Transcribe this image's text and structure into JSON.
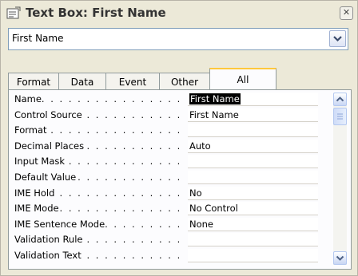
{
  "window": {
    "title": "Text Box: First Name",
    "close_glyph": "✕"
  },
  "object_selector": {
    "value": "First Name"
  },
  "tabs": [
    {
      "label": "Format"
    },
    {
      "label": "Data"
    },
    {
      "label": "Event"
    },
    {
      "label": "Other"
    },
    {
      "label": "All"
    }
  ],
  "active_tab": "All",
  "properties": [
    {
      "label": "Name",
      "value": "First Name"
    },
    {
      "label": "Control Source",
      "value": "First Name"
    },
    {
      "label": "Format",
      "value": ""
    },
    {
      "label": "Decimal Places",
      "value": "Auto"
    },
    {
      "label": "Input Mask",
      "value": ""
    },
    {
      "label": "Default Value",
      "value": ""
    },
    {
      "label": "IME Hold",
      "value": "No"
    },
    {
      "label": "IME Mode",
      "value": "No Control"
    },
    {
      "label": "IME Sentence Mode",
      "value": "None"
    },
    {
      "label": "Validation Rule",
      "value": ""
    },
    {
      "label": "Validation Text",
      "value": ""
    }
  ],
  "icons": {
    "title": "properties-icon",
    "dropdown": "chevron-down-icon",
    "scroll_up": "arrow-up-icon",
    "scroll_down": "arrow-down-icon"
  }
}
